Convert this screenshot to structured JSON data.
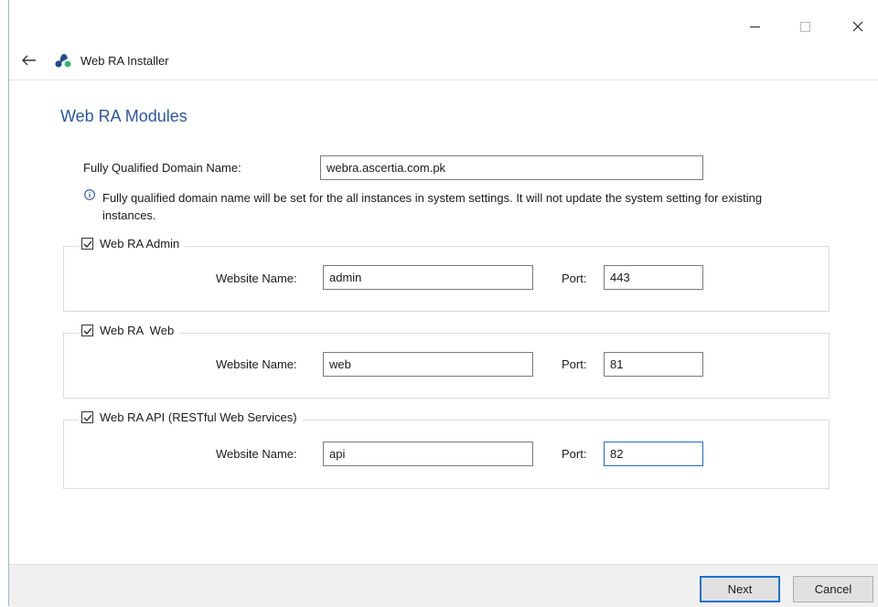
{
  "window": {
    "title": "Web RA Installer",
    "icons": [
      "back-arrow-icon",
      "app-logo-icon",
      "minimize-icon",
      "maximize-icon",
      "close-icon"
    ],
    "logo_colors": [
      "#1e4d8c",
      "#2bb673"
    ]
  },
  "page": {
    "heading": "Web RA Modules",
    "heading_color": "#2b57a7"
  },
  "fqdn": {
    "label": "Fully Qualified Domain Name:",
    "value": "webra.ascertia.com.pk",
    "info": "Fully qualified domain name will be set for the all instances in system settings. It will not update the system setting for existing instances."
  },
  "modules": [
    {
      "label": "Web RA Admin",
      "checked": true,
      "website_label": "Website Name:",
      "website_value": "admin",
      "port_label": "Port:",
      "port_value": "443"
    },
    {
      "label": "Web RA  Web",
      "checked": true,
      "website_label": "Website Name:",
      "website_value": "web",
      "port_label": "Port:",
      "port_value": "81"
    },
    {
      "label": "Web RA API (RESTful Web Services)",
      "checked": true,
      "website_label": "Website Name:",
      "website_value": "api",
      "port_label": "Port:",
      "port_value": "82"
    }
  ],
  "footer": {
    "next_label": "Next",
    "cancel_label": "Cancel",
    "accent_color": "#1c6fd0"
  }
}
